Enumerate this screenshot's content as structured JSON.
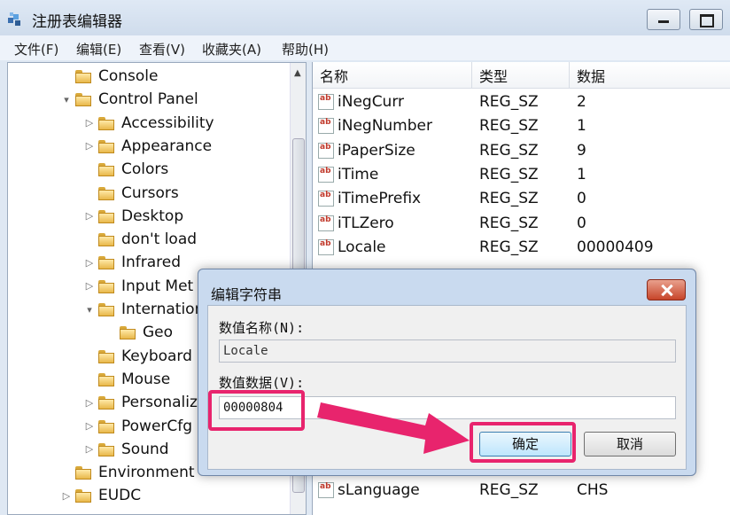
{
  "window": {
    "title": "注册表编辑器",
    "minimize_icon": "minimize-icon",
    "maximize_icon": "maximize-icon"
  },
  "menu": [
    "文件(F)",
    "编辑(E)",
    "查看(V)",
    "收藏夹(A)",
    "帮助(H)"
  ],
  "tree": [
    {
      "label": "Console",
      "depth": 1,
      "arrow": ""
    },
    {
      "label": "Control Panel",
      "depth": 1,
      "arrow": "▾"
    },
    {
      "label": "Accessibility",
      "depth": 2,
      "arrow": "▷"
    },
    {
      "label": "Appearance",
      "depth": 2,
      "arrow": "▷"
    },
    {
      "label": "Colors",
      "depth": 2,
      "arrow": ""
    },
    {
      "label": "Cursors",
      "depth": 2,
      "arrow": ""
    },
    {
      "label": "Desktop",
      "depth": 2,
      "arrow": "▷"
    },
    {
      "label": "don't load",
      "depth": 2,
      "arrow": ""
    },
    {
      "label": "Infrared",
      "depth": 2,
      "arrow": "▷"
    },
    {
      "label": "Input Met",
      "depth": 2,
      "arrow": "▷"
    },
    {
      "label": "Internation",
      "depth": 2,
      "arrow": "▾"
    },
    {
      "label": "Geo",
      "depth": 3,
      "arrow": ""
    },
    {
      "label": "Keyboard",
      "depth": 2,
      "arrow": ""
    },
    {
      "label": "Mouse",
      "depth": 2,
      "arrow": ""
    },
    {
      "label": "Personaliz",
      "depth": 2,
      "arrow": "▷"
    },
    {
      "label": "PowerCfg",
      "depth": 2,
      "arrow": "▷"
    },
    {
      "label": "Sound",
      "depth": 2,
      "arrow": "▷"
    },
    {
      "label": "Environment",
      "depth": 1,
      "arrow": ""
    },
    {
      "label": "EUDC",
      "depth": 1,
      "arrow": "▷"
    }
  ],
  "list": {
    "columns": [
      "名称",
      "类型",
      "数据"
    ],
    "rows": [
      {
        "name": "iNegCurr",
        "type": "REG_SZ",
        "data": "2"
      },
      {
        "name": "iNegNumber",
        "type": "REG_SZ",
        "data": "1"
      },
      {
        "name": "iPaperSize",
        "type": "REG_SZ",
        "data": "9"
      },
      {
        "name": "iTime",
        "type": "REG_SZ",
        "data": "1"
      },
      {
        "name": "iTimePrefix",
        "type": "REG_SZ",
        "data": "0"
      },
      {
        "name": "iTLZero",
        "type": "REG_SZ",
        "data": "0"
      },
      {
        "name": "Locale",
        "type": "REG_SZ",
        "data": "00000409"
      }
    ],
    "bottom_rows": [
      {
        "name": "sLanguage",
        "type": "REG_SZ",
        "data": "CHS"
      }
    ]
  },
  "dialog": {
    "title": "编辑字符串",
    "name_label": "数值名称(N):",
    "name_value": "Locale",
    "data_label": "数值数据(V):",
    "data_value": "00000804",
    "ok_label": "确定",
    "cancel_label": "取消"
  },
  "colors": {
    "highlight": "#e8246d"
  }
}
